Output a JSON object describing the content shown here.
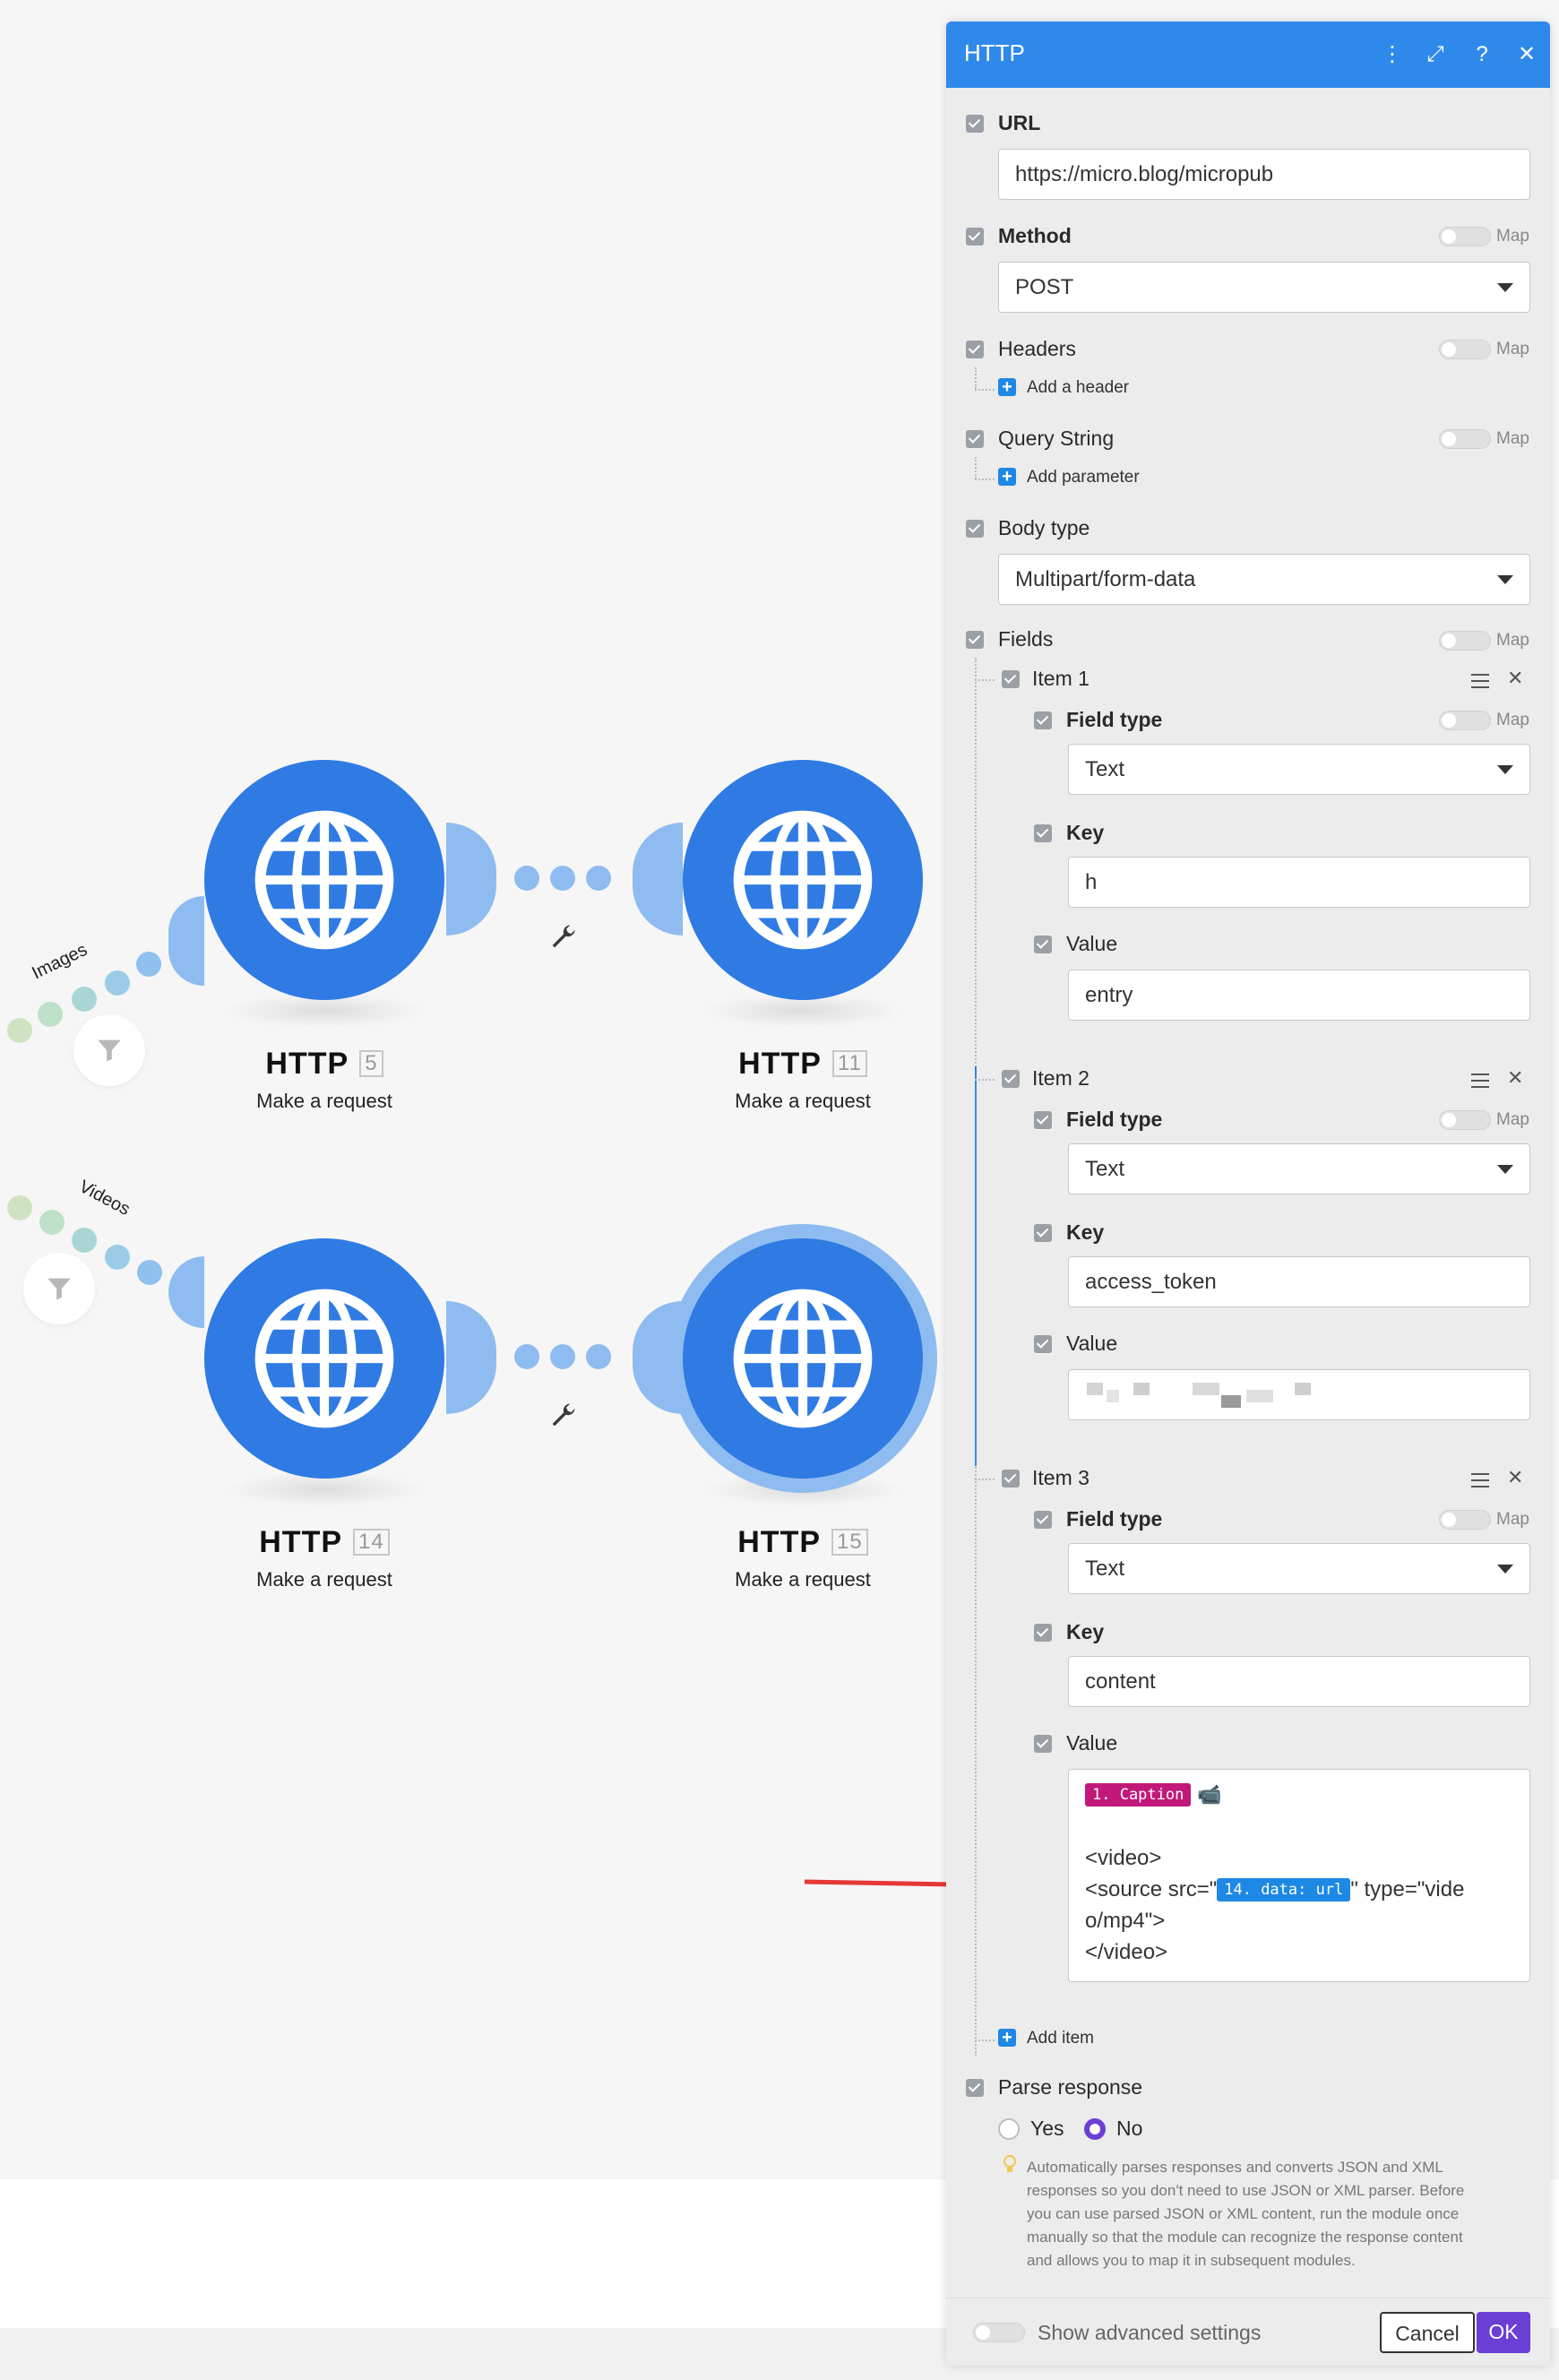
{
  "panel": {
    "title": "HTTP",
    "url": {
      "label": "URL",
      "value": "https://micro.blog/micropub"
    },
    "method": {
      "label": "Method",
      "value": "POST",
      "map_label": "Map"
    },
    "headers": {
      "label": "Headers",
      "map_label": "Map",
      "add_label": "Add a header"
    },
    "query_string": {
      "label": "Query String",
      "map_label": "Map",
      "add_label": "Add parameter"
    },
    "body_type": {
      "label": "Body type",
      "value": "Multipart/form-data"
    },
    "fields": {
      "label": "Fields",
      "map_label": "Map",
      "add_item_label": "Add item",
      "items": [
        {
          "title": "Item 1",
          "field_type_label": "Field type",
          "field_type_value": "Text",
          "map_label": "Map",
          "key_label": "Key",
          "key_value": "h",
          "value_label": "Value",
          "value_value": "entry"
        },
        {
          "title": "Item 2",
          "field_type_label": "Field type",
          "field_type_value": "Text",
          "map_label": "Map",
          "key_label": "Key",
          "key_value": "access_token",
          "value_label": "Value",
          "value_value": ""
        },
        {
          "title": "Item 3",
          "field_type_label": "Field type",
          "field_type_value": "Text",
          "map_label": "Map",
          "key_label": "Key",
          "key_value": "content",
          "value_label": "Value",
          "value_tag1": "1. Caption",
          "value_line1": "<video>",
          "value_line2_prefix": "<source src=\"",
          "value_tag2": "14. data: url",
          "value_line2_suffix": "\" type=\"vide",
          "value_line3": "o/mp4\">",
          "value_line4": "</video>"
        }
      ]
    },
    "parse_response": {
      "label": "Parse response",
      "yes_label": "Yes",
      "no_label": "No",
      "selected": "No",
      "help_lines": [
        "Automatically parses responses and converts JSON and XML",
        "responses so you don't need to use JSON or XML parser. Before",
        "you can use parsed JSON or XML content, run the module once",
        "manually so that the module can recognize the response content",
        "and allows you to map it in subsequent modules."
      ]
    },
    "footer": {
      "advanced_label": "Show advanced settings",
      "cancel_label": "Cancel",
      "ok_label": "OK"
    }
  },
  "canvas": {
    "routes": [
      {
        "label": "Images"
      },
      {
        "label": "Videos"
      }
    ],
    "modules": [
      {
        "title": "HTTP",
        "number": "5",
        "subtitle": "Make a request"
      },
      {
        "title": "HTTP",
        "number": "11",
        "subtitle": "Make a request"
      },
      {
        "title": "HTTP",
        "number": "14",
        "subtitle": "Make a request"
      },
      {
        "title": "HTTP",
        "number": "15",
        "subtitle": "Make a request"
      }
    ]
  },
  "colors": {
    "accent": "#2e89ea",
    "module": "#2f7be3",
    "tag_pink": "#c2187a",
    "tag_blue": "#1e88e5",
    "radio": "#6b3fd6",
    "ok": "#6b3fd6",
    "arrow": "#e53935"
  },
  "icons": [
    "globe-icon",
    "filter-icon",
    "wrench-icon",
    "menu-dots-icon",
    "expand-icon",
    "help-icon",
    "close-icon",
    "hamburger-icon",
    "bulb-icon",
    "camera-icon"
  ]
}
